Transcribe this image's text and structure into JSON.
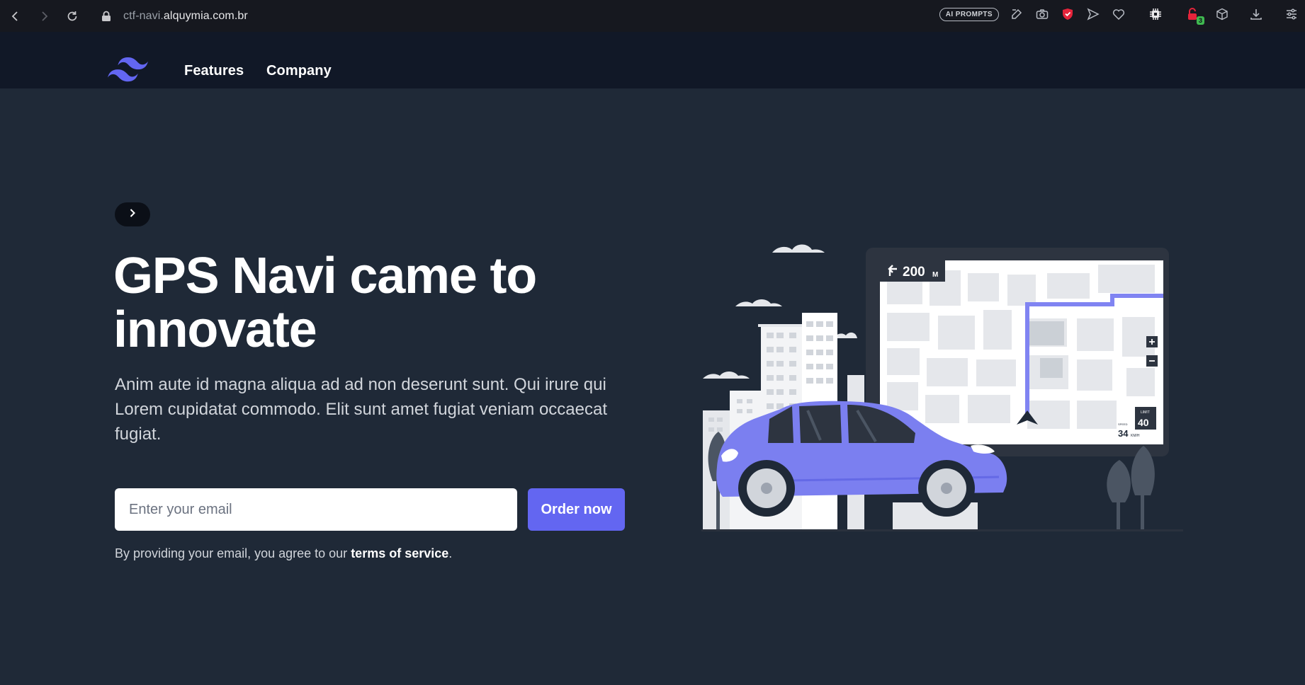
{
  "browser": {
    "url_prefix": "ctf-navi.",
    "url_host": "alquymia.com.br",
    "ai_prompts_label": "AI PROMPTS",
    "extension_badge": "3",
    "icons": [
      "back-icon",
      "forward-icon",
      "reload-icon",
      "lock-icon",
      "edit-icon",
      "camera-icon",
      "shield-icon",
      "send-icon",
      "heart-icon",
      "chip-icon",
      "lock-extension-icon",
      "cube-icon",
      "download-icon",
      "sliders-icon"
    ]
  },
  "header": {
    "logo": "tailwind-logo-icon",
    "nav": [
      {
        "label": "Features"
      },
      {
        "label": "Company"
      }
    ]
  },
  "hero": {
    "title": "GPS Navi came to innovate",
    "subtitle": "Anim aute id magna aliqua ad ad non deserunt sunt. Qui irure qui Lorem cupidatat commodo. Elit sunt amet fugiat veniam occaecat fugiat.",
    "email_placeholder": "Enter your email",
    "cta_label": "Order now",
    "terms_prefix": "By providing your email, you agree to our ",
    "terms_link": "terms of service",
    "terms_suffix": "."
  },
  "illustration": {
    "direction_distance": "200",
    "direction_unit": "M",
    "limit_label": "LIMIT",
    "limit_value": "40",
    "speed_label": "SPEED",
    "speed_value": "34",
    "speed_unit": "KM/H"
  },
  "colors": {
    "page_bg": "#1f2937",
    "header_bg": "#111827",
    "accent": "#6366f1",
    "car": "#7b7ff0"
  }
}
